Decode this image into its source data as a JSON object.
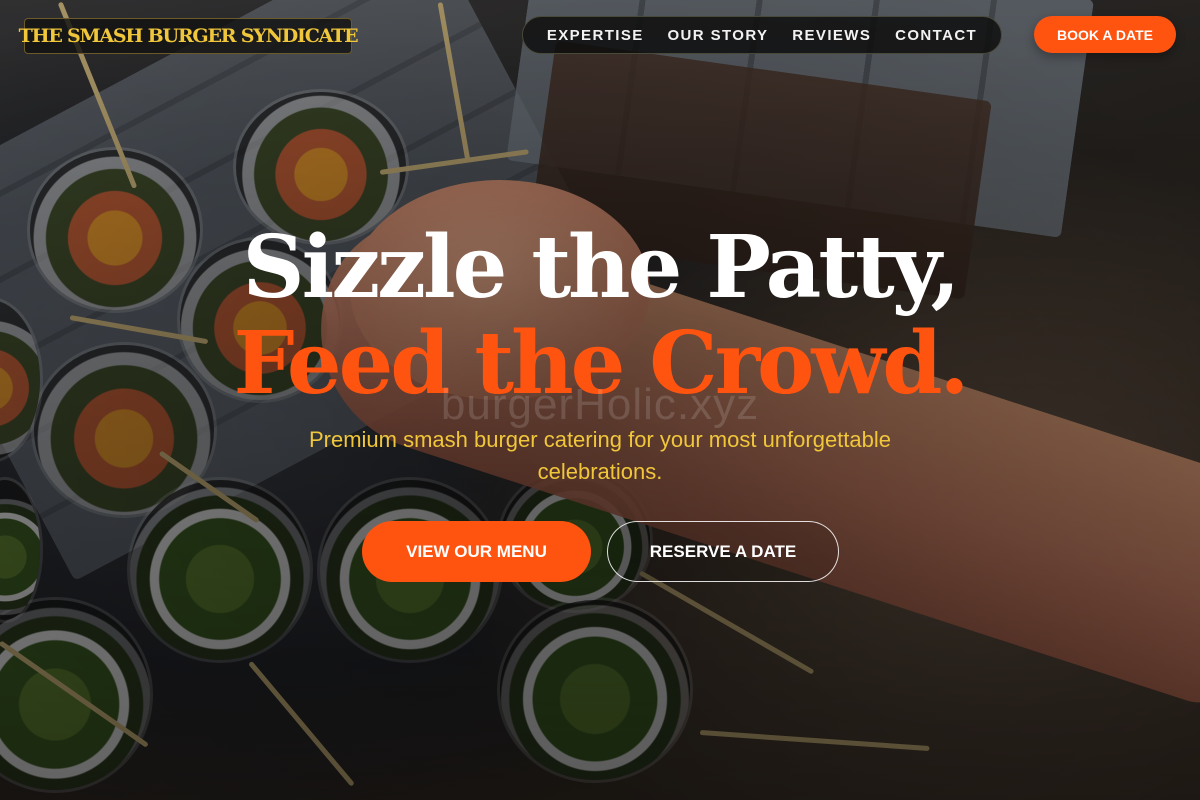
{
  "brand": {
    "name": "THE SMASH BURGER SYNDICATE"
  },
  "nav": {
    "items": [
      {
        "label": "EXPERTISE"
      },
      {
        "label": "OUR STORY"
      },
      {
        "label": "REVIEWS"
      },
      {
        "label": "CONTACT"
      }
    ],
    "cta_label": "BOOK A DATE"
  },
  "hero": {
    "title_line_1": "Sizzle the Patty,",
    "title_line_2": "Feed the Crowd.",
    "watermark": "burgerHolic.xyz",
    "subtitle": "Premium smash burger catering for your most unforgettable celebrations.",
    "primary_cta": "VIEW OUR MENU",
    "secondary_cta": "RESERVE A DATE"
  },
  "colors": {
    "accent": "#ff5410",
    "brand_gold": "#f0c63a",
    "text_light": "#ffffff",
    "nav_bg": "#0e0e0e"
  }
}
